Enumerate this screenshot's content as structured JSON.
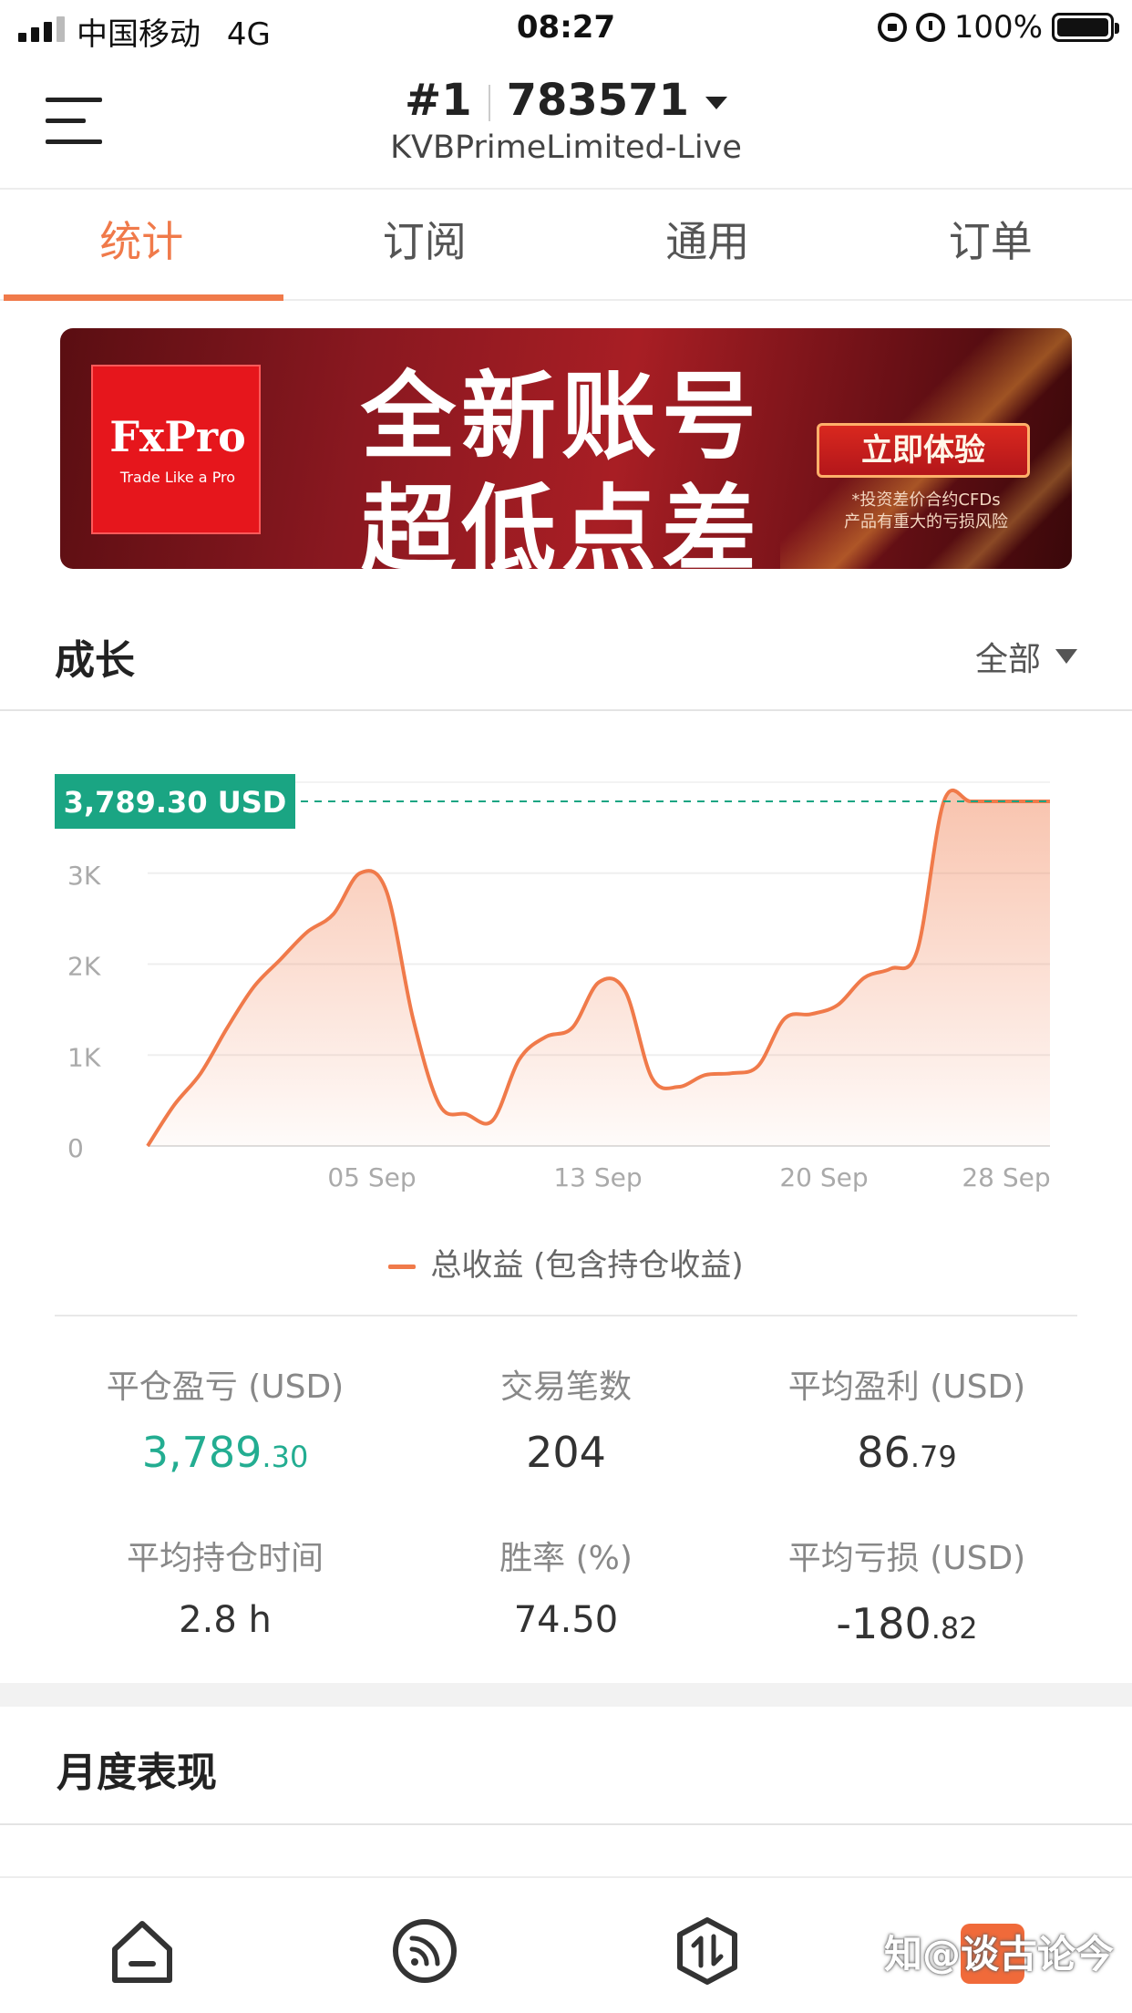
{
  "status_bar": {
    "carrier": "中国移动",
    "network": "4G",
    "time": "08:27",
    "battery": "100%"
  },
  "header": {
    "account_index": "#1",
    "account_number": "783571",
    "broker": "KVBPrimeLimited-Live"
  },
  "tabs": [
    {
      "label": "统计",
      "active": true
    },
    {
      "label": "订阅",
      "active": false
    },
    {
      "label": "通用",
      "active": false
    },
    {
      "label": "订单",
      "active": false
    }
  ],
  "banner": {
    "logo_name": "FxPro",
    "logo_tagline": "Trade Like a Pro",
    "line1": "全新账号",
    "line2": "超低点差",
    "cta": "立即体验",
    "note1": "*投资差价合约CFDs",
    "note2": "产品有重大的亏损风险"
  },
  "growth": {
    "title": "成长",
    "range": "全部"
  },
  "chart_data": {
    "type": "area",
    "current_label": "3,789.30 USD",
    "current_value": 3789.3,
    "ylim": [
      0,
      4000
    ],
    "y_ticks": [
      "0",
      "1K",
      "2K",
      "3K"
    ],
    "x_ticks": [
      "05 Sep",
      "13 Sep",
      "20 Sep",
      "28 Sep"
    ],
    "series": [
      {
        "name": "总收益 (包含持仓收益)",
        "x": [
          0,
          1,
          2,
          3,
          4,
          5,
          6,
          7,
          8,
          9,
          10,
          11,
          12,
          13,
          14,
          15,
          16,
          17,
          18,
          19,
          20,
          21,
          22,
          23,
          24,
          25,
          26,
          27,
          28,
          29,
          30,
          31,
          32,
          33,
          34
        ],
        "values": [
          0,
          450,
          800,
          1300,
          1750,
          2050,
          2350,
          2550,
          3000,
          2800,
          1400,
          450,
          350,
          280,
          950,
          1200,
          1300,
          1800,
          1700,
          750,
          650,
          780,
          800,
          880,
          1400,
          1450,
          1550,
          1850,
          1950,
          2150,
          3789.3,
          3789.3,
          3789.3,
          3789.3,
          3789.3
        ]
      }
    ],
    "color": "#f07a4a",
    "label_color": "#1aa583"
  },
  "legend_label": "总收益 (包含持仓收益)",
  "stats": [
    {
      "label": "平仓盈亏 (USD)",
      "int": "3,789",
      "dec": ".30",
      "green": true
    },
    {
      "label": "交易笔数",
      "int": "204",
      "dec": "",
      "green": false
    },
    {
      "label": "平均盈利 (USD)",
      "int": "86",
      "dec": ".79",
      "green": false
    },
    {
      "label": "平均持仓时间",
      "int": "2.8 h",
      "dec": "",
      "green": false
    },
    {
      "label": "胜率 (%)",
      "int": "74.50",
      "dec": "",
      "green": false
    },
    {
      "label": "平均亏损 (USD)",
      "int": "-180",
      "dec": ".82",
      "green": false
    }
  ],
  "monthly": {
    "title": "月度表现"
  },
  "watermark": "知@谈古论今"
}
